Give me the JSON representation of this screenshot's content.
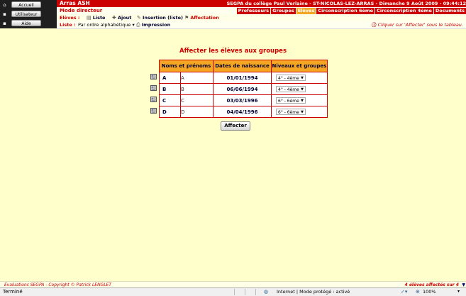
{
  "sidebar": {
    "buttons": [
      {
        "label": "Accueil",
        "icon": "home-icon"
      },
      {
        "label": "Utilisateur",
        "icon": "user-icon"
      },
      {
        "label": "Aide",
        "icon": "help-icon"
      }
    ]
  },
  "header": {
    "app_title": "Arras ASH",
    "school_info": "SEGPA du collège Paul Verlaine - ST-NICOLAS-LEZ-ARRAS - Dimanche 9 Août 2009 - 09:44:12",
    "mode": "Mode directeur",
    "tabs": [
      {
        "label": "Professeurs",
        "active": false
      },
      {
        "label": "Groupes",
        "active": false
      },
      {
        "label": "Elèves",
        "active": true
      },
      {
        "label": "Circonscription 6ème",
        "active": false
      },
      {
        "label": "Circonscription 4ème",
        "active": false
      },
      {
        "label": "Documents",
        "active": false
      }
    ]
  },
  "toolbar": {
    "section_label": "Elèves :",
    "items": {
      "liste": "Liste",
      "ajout": "Ajout",
      "insertion": "Insertion (liste)",
      "affectation": "Affectation"
    }
  },
  "list_bar": {
    "label": "Liste :",
    "sort_value": "Par ordre alphabétique",
    "print_label": "Impression",
    "hint": "Cliquer sur 'Affecter' sous le tableau."
  },
  "main": {
    "heading": "Affecter les élèves aux groupes",
    "columns": [
      "Noms et prénoms",
      "Dates de naissance",
      "Niveaux et groupes"
    ],
    "rows": [
      {
        "nom": "A",
        "prenom": "A",
        "date": "01/01/1994",
        "niveau": "4° - 4ème"
      },
      {
        "nom": "B",
        "prenom": "B",
        "date": "06/06/1994",
        "niveau": "4° - 4ème"
      },
      {
        "nom": "C",
        "prenom": "C",
        "date": "03/03/1996",
        "niveau": "6° - 6ème"
      },
      {
        "nom": "D",
        "prenom": "D",
        "date": "04/04/1996",
        "niveau": "6° - 6ème"
      }
    ],
    "submit_label": "Affecter"
  },
  "footer": {
    "copyright": "Evaluations SEGPA - Copyright © Patrick LENGLET",
    "count": "4 élèves affectés sur 4"
  },
  "statusbar": {
    "status": "Terminé",
    "zone": "Internet | Mode protégé : activé",
    "zoom": "100%"
  },
  "colors": {
    "header_red": "#CC0000",
    "active_tab": "#F5A623",
    "background": "#FFFFCC",
    "table_header": "#F5A623"
  }
}
